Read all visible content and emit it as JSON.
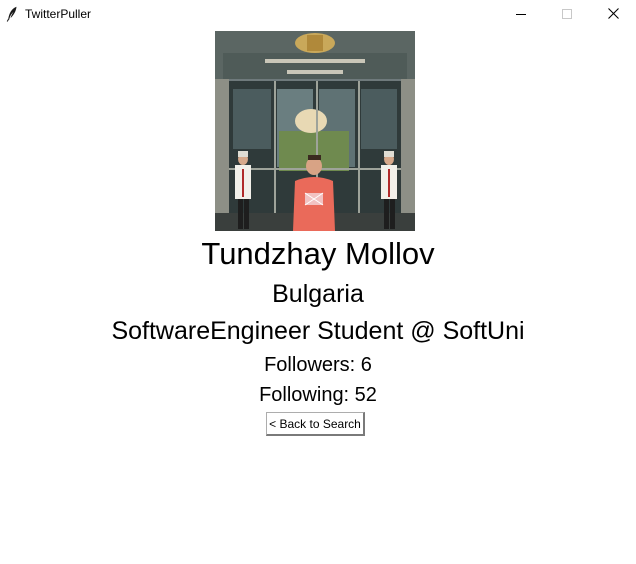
{
  "window": {
    "title": "TwitterPuller",
    "app_icon": "feather-icon",
    "controls": [
      "minimize-icon",
      "maximize-icon",
      "close-icon"
    ]
  },
  "profile": {
    "image": "profile-photo",
    "name": "Tundzhay Mollov",
    "location": "Bulgaria",
    "description": "SoftwareEngineer Student @ SoftUni",
    "followers": "Followers: 6",
    "following": "Following: 52"
  },
  "actions": {
    "back_label": "< Back to Search"
  },
  "colors": {
    "background": "#ffffff",
    "text": "#000000",
    "button_border": "#adadad"
  }
}
